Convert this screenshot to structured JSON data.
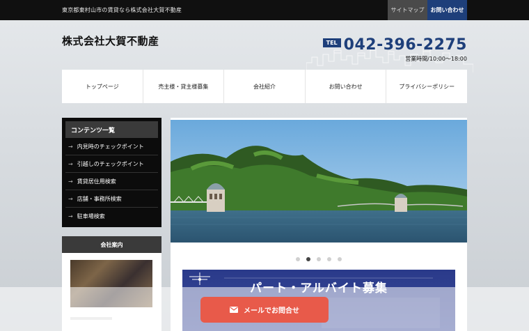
{
  "topbar": {
    "tagline": "東京都東村山市の賃貸なら株式会社大賀不動産",
    "sitemap": "サイトマップ",
    "contact": "お問い合わせ"
  },
  "header": {
    "company": "株式会社大賀不動産",
    "tel_label": "TEL",
    "tel_number": "042-396-2275",
    "hours": "営業時間/10:00～18:00"
  },
  "nav": [
    "トップページ",
    "売主様・貸主様募集",
    "会社紹介",
    "お問い合わせ",
    "プライバシーポリシー"
  ],
  "sidebar": {
    "title": "コンテンツ一覧",
    "items": [
      "内見時のチェックポイント",
      "引越しのチェックポイント",
      "賃貸居住用検索",
      "店舗・事務所検索",
      "駐車場検索"
    ],
    "office_title": "会社案内"
  },
  "slider": {
    "dot_count": 5,
    "active_index": 1
  },
  "banner": {
    "title": "パート・アルバイト募集"
  },
  "mail_button": {
    "label": "メールでお問合せ"
  },
  "colors": {
    "brand_blue": "#1e3f7a",
    "accent_red": "#e85a4a"
  }
}
